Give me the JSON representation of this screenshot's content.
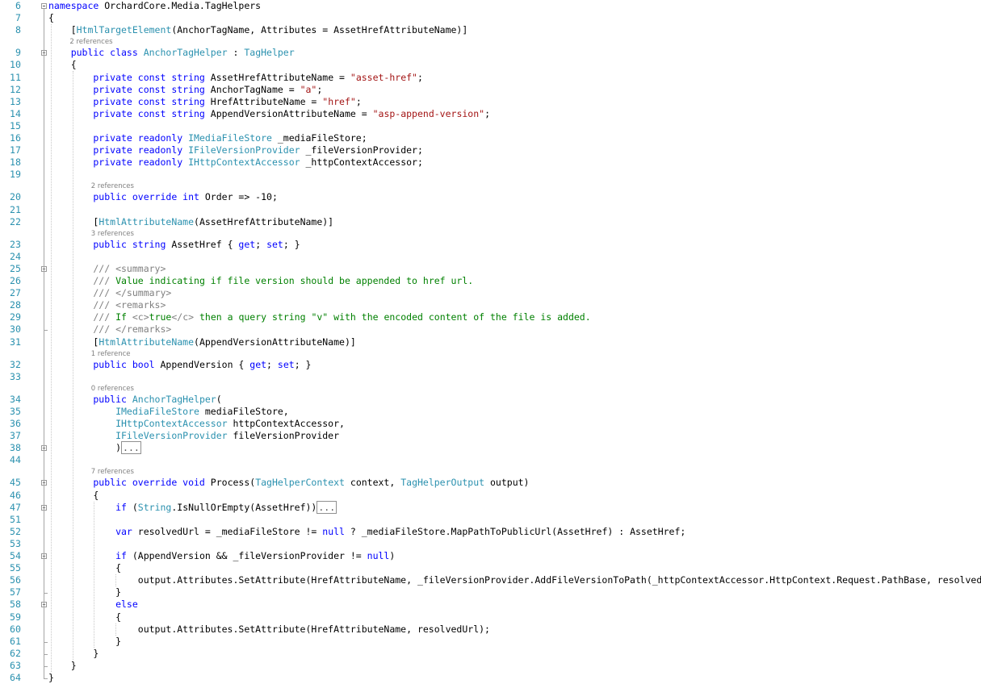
{
  "editor": {
    "lines": [
      {
        "n": "6",
        "segs": [
          [
            "k",
            "namespace"
          ],
          [
            "p",
            " OrchardCore.Media.TagHelpers"
          ]
        ]
      },
      {
        "n": "7",
        "segs": [
          [
            "p",
            "{"
          ]
        ]
      },
      {
        "n": "8",
        "segs": [
          [
            "p",
            "    ["
          ],
          [
            "t",
            "HtmlTargetElement"
          ],
          [
            "p",
            "(AnchorTagName, Attributes = AssetHrefAttributeName)]"
          ]
        ]
      },
      {
        "n": "9",
        "lens": "2 references",
        "segs": [
          [
            "k",
            "    public class "
          ],
          [
            "t",
            "AnchorTagHelper"
          ],
          [
            "p",
            " : "
          ],
          [
            "t",
            "TagHelper"
          ]
        ]
      },
      {
        "n": "10",
        "segs": [
          [
            "p",
            "    {"
          ]
        ]
      },
      {
        "n": "11",
        "segs": [
          [
            "k",
            "        private const string "
          ],
          [
            "p",
            "AssetHrefAttributeName = "
          ],
          [
            "s",
            "\"asset-href\""
          ],
          [
            "p",
            ";"
          ]
        ]
      },
      {
        "n": "12",
        "segs": [
          [
            "k",
            "        private const string "
          ],
          [
            "p",
            "AnchorTagName = "
          ],
          [
            "s",
            "\"a\""
          ],
          [
            "p",
            ";"
          ]
        ]
      },
      {
        "n": "13",
        "segs": [
          [
            "k",
            "        private const string "
          ],
          [
            "p",
            "HrefAttributeName = "
          ],
          [
            "s",
            "\"href\""
          ],
          [
            "p",
            ";"
          ]
        ]
      },
      {
        "n": "14",
        "segs": [
          [
            "k",
            "        private const string "
          ],
          [
            "p",
            "AppendVersionAttributeName = "
          ],
          [
            "s",
            "\"asp-append-version\""
          ],
          [
            "p",
            ";"
          ]
        ]
      },
      {
        "n": "15",
        "segs": []
      },
      {
        "n": "16",
        "segs": [
          [
            "k",
            "        private readonly "
          ],
          [
            "t",
            "IMediaFileStore"
          ],
          [
            "p",
            " _mediaFileStore;"
          ]
        ]
      },
      {
        "n": "17",
        "segs": [
          [
            "k",
            "        private readonly "
          ],
          [
            "t",
            "IFileVersionProvider"
          ],
          [
            "p",
            " _fileVersionProvider;"
          ]
        ]
      },
      {
        "n": "18",
        "segs": [
          [
            "k",
            "        private readonly "
          ],
          [
            "t",
            "IHttpContextAccessor"
          ],
          [
            "p",
            " _httpContextAccessor;"
          ]
        ]
      },
      {
        "n": "19",
        "segs": []
      },
      {
        "n": "20",
        "lens": "2 references",
        "segs": [
          [
            "k",
            "        public override int "
          ],
          [
            "p",
            "Order => -10;"
          ]
        ]
      },
      {
        "n": "21",
        "segs": []
      },
      {
        "n": "22",
        "segs": [
          [
            "p",
            "        ["
          ],
          [
            "t",
            "HtmlAttributeName"
          ],
          [
            "p",
            "(AssetHrefAttributeName)]"
          ]
        ]
      },
      {
        "n": "23",
        "lens": "3 references",
        "segs": [
          [
            "k",
            "        public string "
          ],
          [
            "p",
            "AssetHref { "
          ],
          [
            "k",
            "get"
          ],
          [
            "p",
            "; "
          ],
          [
            "k",
            "set"
          ],
          [
            "p",
            "; }"
          ]
        ]
      },
      {
        "n": "24",
        "segs": []
      },
      {
        "n": "25",
        "segs": [
          [
            "x",
            "        /// <summary>"
          ]
        ]
      },
      {
        "n": "26",
        "segs": [
          [
            "x",
            "        /// "
          ],
          [
            "c",
            "Value indicating if file version should be appended to href url."
          ]
        ]
      },
      {
        "n": "27",
        "segs": [
          [
            "x",
            "        /// </summary>"
          ]
        ]
      },
      {
        "n": "28",
        "segs": [
          [
            "x",
            "        /// <remarks>"
          ]
        ]
      },
      {
        "n": "29",
        "segs": [
          [
            "x",
            "        /// "
          ],
          [
            "c",
            "If "
          ],
          [
            "x",
            "<c>"
          ],
          [
            "c",
            "true"
          ],
          [
            "x",
            "</c>"
          ],
          [
            "c",
            " then a query string \"v\" with the encoded content of the file is added."
          ]
        ]
      },
      {
        "n": "30",
        "segs": [
          [
            "x",
            "        /// </remarks>"
          ]
        ]
      },
      {
        "n": "31",
        "segs": [
          [
            "p",
            "        ["
          ],
          [
            "t",
            "HtmlAttributeName"
          ],
          [
            "p",
            "(AppendVersionAttributeName)]"
          ]
        ]
      },
      {
        "n": "32",
        "lens": "1 reference",
        "segs": [
          [
            "k",
            "        public bool "
          ],
          [
            "p",
            "AppendVersion { "
          ],
          [
            "k",
            "get"
          ],
          [
            "p",
            "; "
          ],
          [
            "k",
            "set"
          ],
          [
            "p",
            "; }"
          ]
        ]
      },
      {
        "n": "33",
        "segs": []
      },
      {
        "n": "34",
        "lens": "0 references",
        "segs": [
          [
            "k",
            "        public "
          ],
          [
            "t",
            "AnchorTagHelper"
          ],
          [
            "p",
            "("
          ]
        ]
      },
      {
        "n": "35",
        "segs": [
          [
            "t",
            "            IMediaFileStore"
          ],
          [
            "p",
            " mediaFileStore,"
          ]
        ]
      },
      {
        "n": "36",
        "segs": [
          [
            "t",
            "            IHttpContextAccessor"
          ],
          [
            "p",
            " httpContextAccessor,"
          ]
        ]
      },
      {
        "n": "37",
        "segs": [
          [
            "t",
            "            IFileVersionProvider"
          ],
          [
            "p",
            " fileVersionProvider"
          ]
        ]
      },
      {
        "n": "38",
        "segs": [
          [
            "p",
            "            )"
          ],
          [
            "box",
            "..."
          ]
        ]
      },
      {
        "n": "44",
        "segs": []
      },
      {
        "n": "45",
        "lens": "7 references",
        "segs": [
          [
            "k",
            "        public override void "
          ],
          [
            "p",
            "Process("
          ],
          [
            "t",
            "TagHelperContext"
          ],
          [
            "p",
            " context, "
          ],
          [
            "t",
            "TagHelperOutput"
          ],
          [
            "p",
            " output)"
          ]
        ]
      },
      {
        "n": "46",
        "segs": [
          [
            "p",
            "        {"
          ]
        ]
      },
      {
        "n": "47",
        "segs": [
          [
            "k",
            "            if "
          ],
          [
            "p",
            "("
          ],
          [
            "t",
            "String"
          ],
          [
            "p",
            ".IsNullOrEmpty(AssetHref))"
          ],
          [
            "box",
            "..."
          ]
        ]
      },
      {
        "n": "51",
        "segs": []
      },
      {
        "n": "52",
        "segs": [
          [
            "k",
            "            var "
          ],
          [
            "p",
            "resolvedUrl = _mediaFileStore != "
          ],
          [
            "k",
            "null"
          ],
          [
            "p",
            " ? _mediaFileStore.MapPathToPublicUrl(AssetHref) : AssetHref;"
          ]
        ]
      },
      {
        "n": "53",
        "segs": []
      },
      {
        "n": "54",
        "segs": [
          [
            "k",
            "            if "
          ],
          [
            "p",
            "(AppendVersion && _fileVersionProvider != "
          ],
          [
            "k",
            "null"
          ],
          [
            "p",
            ")"
          ]
        ]
      },
      {
        "n": "55",
        "segs": [
          [
            "p",
            "            {"
          ]
        ]
      },
      {
        "n": "56",
        "segs": [
          [
            "p",
            "                output.Attributes.SetAttribute(HrefAttributeName, _fileVersionProvider.AddFileVersionToPath(_httpContextAccessor.HttpContext.Request.PathBase, resolvedUrl));"
          ]
        ]
      },
      {
        "n": "57",
        "segs": [
          [
            "p",
            "            }"
          ]
        ]
      },
      {
        "n": "58",
        "segs": [
          [
            "k",
            "            else"
          ]
        ]
      },
      {
        "n": "59",
        "segs": [
          [
            "p",
            "            {"
          ]
        ]
      },
      {
        "n": "60",
        "segs": [
          [
            "p",
            "                output.Attributes.SetAttribute(HrefAttributeName, resolvedUrl);"
          ]
        ]
      },
      {
        "n": "61",
        "segs": [
          [
            "p",
            "            }"
          ]
        ]
      },
      {
        "n": "62",
        "segs": [
          [
            "p",
            "        }"
          ]
        ]
      },
      {
        "n": "63",
        "segs": [
          [
            "p",
            "    }"
          ]
        ]
      },
      {
        "n": "64",
        "segs": [
          [
            "p",
            "}"
          ]
        ]
      }
    ]
  }
}
